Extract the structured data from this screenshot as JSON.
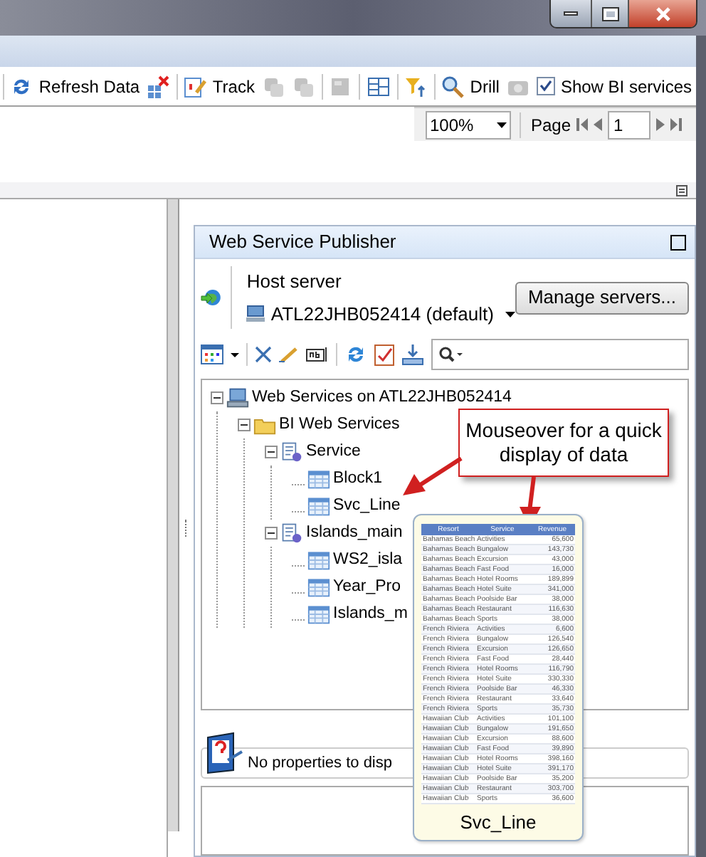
{
  "toolbar": {
    "items": [
      {
        "kind": "button",
        "label": "Refresh Data",
        "disabled": false
      },
      {
        "kind": "button",
        "disabled": false
      },
      {
        "kind": "button",
        "label": "Track",
        "disabled": false
      },
      {
        "kind": "button",
        "disabled": true
      },
      {
        "kind": "button",
        "disabled": true
      },
      {
        "kind": "button",
        "disabled": true
      },
      {
        "kind": "button",
        "disabled": false
      },
      {
        "kind": "button",
        "disabled": false
      },
      {
        "kind": "button",
        "label": "Drill",
        "disabled": false
      },
      {
        "kind": "button",
        "disabled": true
      },
      {
        "kind": "checkbox",
        "label": "Show BI services",
        "checked": true
      }
    ]
  },
  "page_bar": {
    "zoom": "100%",
    "page_label": "Page",
    "page": "1"
  },
  "panel": {
    "title": "Web Service Publisher",
    "host_label": "Host server",
    "host": "ATL22JHB052414 (default)",
    "manage_button": "Manage servers...",
    "tree": [
      {
        "label": "Web Services on ATL22JHB052414",
        "kind": "server",
        "expanded": true,
        "children": [
          {
            "label": "BI Web Services",
            "kind": "folder",
            "expanded": true,
            "children": [
              {
                "label": "Service",
                "kind": "service",
                "expanded": true,
                "children": [
                  {
                    "label": "Block1",
                    "kind": "table"
                  },
                  {
                    "label": "Svc_Line",
                    "kind": "table"
                  }
                ]
              },
              {
                "label": "Islands_main",
                "kind": "service",
                "expanded": true,
                "children": [
                  {
                    "label": "WS2_isla",
                    "kind": "table"
                  },
                  {
                    "label": "Year_Pro",
                    "kind": "table"
                  },
                  {
                    "label": "Islands_m",
                    "kind": "table"
                  }
                ]
              }
            ]
          }
        ]
      }
    ],
    "properties": "No properties to disp"
  },
  "callout": "Mouseover for a quick display of data",
  "preview": {
    "caption": "Svc_Line",
    "columns": [
      "Resort",
      "Service",
      "Revenue"
    ],
    "rows": [
      [
        "Bahamas Beach",
        "Activities",
        "65,600"
      ],
      [
        "Bahamas Beach",
        "Bungalow",
        "143,730"
      ],
      [
        "Bahamas Beach",
        "Excursion",
        "43,000"
      ],
      [
        "Bahamas Beach",
        "Fast Food",
        "16,000"
      ],
      [
        "Bahamas Beach",
        "Hotel Rooms",
        "189,899"
      ],
      [
        "Bahamas Beach",
        "Hotel Suite",
        "341,000"
      ],
      [
        "Bahamas Beach",
        "Poolside Bar",
        "38,000"
      ],
      [
        "Bahamas Beach",
        "Restaurant",
        "116,630"
      ],
      [
        "Bahamas Beach",
        "Sports",
        "38,000"
      ],
      [
        "French Riviera",
        "Activities",
        "6,600"
      ],
      [
        "French Riviera",
        "Bungalow",
        "126,540"
      ],
      [
        "French Riviera",
        "Excursion",
        "126,650"
      ],
      [
        "French Riviera",
        "Fast Food",
        "28,440"
      ],
      [
        "French Riviera",
        "Hotel Rooms",
        "116,790"
      ],
      [
        "French Riviera",
        "Hotel Suite",
        "330,330"
      ],
      [
        "French Riviera",
        "Poolside Bar",
        "46,330"
      ],
      [
        "French Riviera",
        "Restaurant",
        "33,640"
      ],
      [
        "French Riviera",
        "Sports",
        "35,730"
      ],
      [
        "Hawaiian Club",
        "Activities",
        "101,100"
      ],
      [
        "Hawaiian Club",
        "Bungalow",
        "191,650"
      ],
      [
        "Hawaiian Club",
        "Excursion",
        "88,600"
      ],
      [
        "Hawaiian Club",
        "Fast Food",
        "39,890"
      ],
      [
        "Hawaiian Club",
        "Hotel Rooms",
        "398,160"
      ],
      [
        "Hawaiian Club",
        "Hotel Suite",
        "391,170"
      ],
      [
        "Hawaiian Club",
        "Poolside Bar",
        "35,200"
      ],
      [
        "Hawaiian Club",
        "Restaurant",
        "303,700"
      ],
      [
        "Hawaiian Club",
        "Sports",
        "36,600"
      ]
    ]
  }
}
